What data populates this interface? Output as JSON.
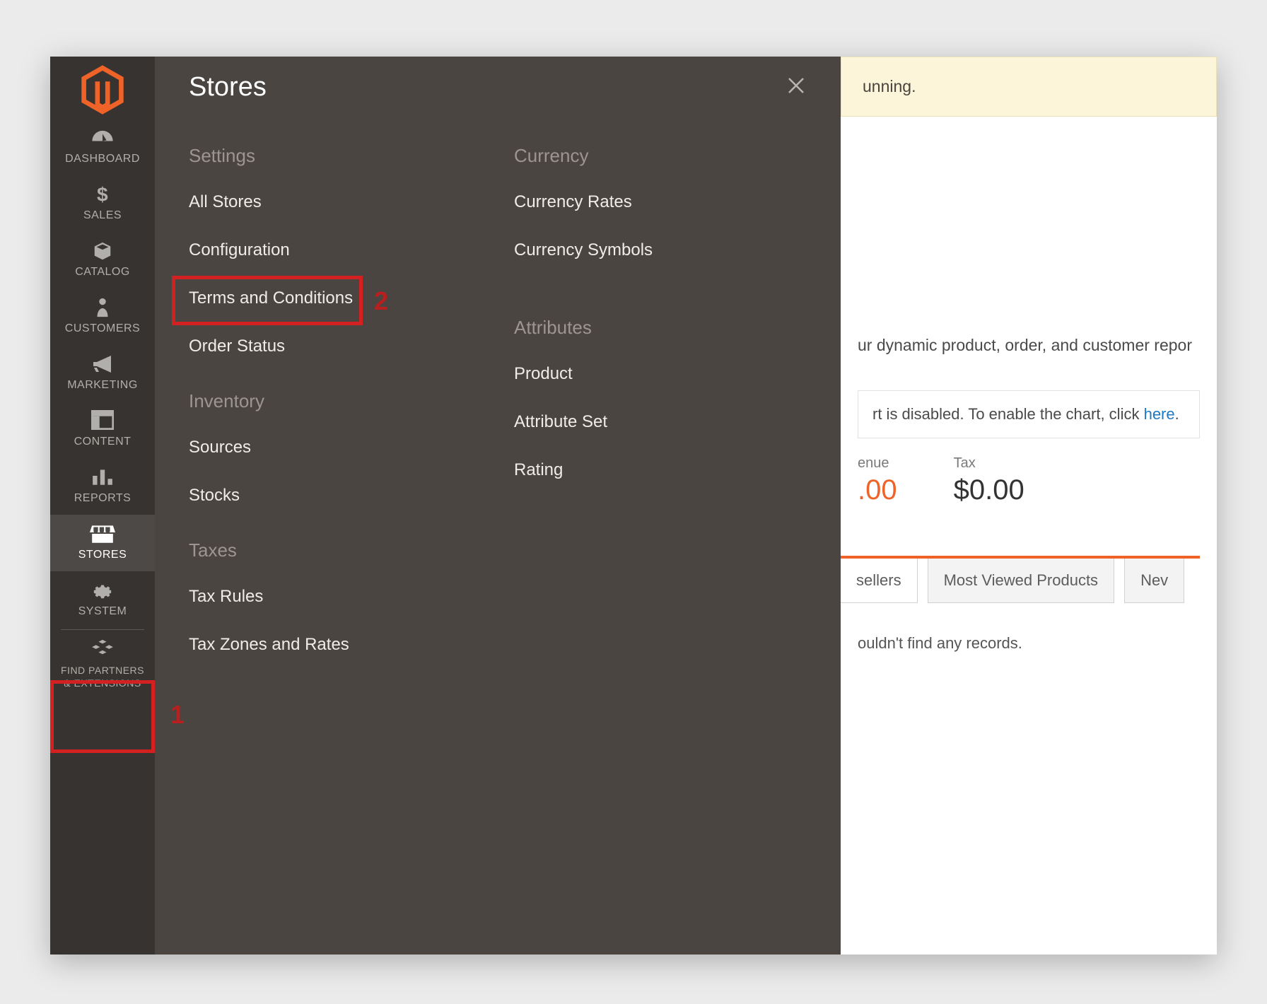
{
  "sidebar": {
    "items": [
      {
        "id": "dashboard",
        "label": "DASHBOARD"
      },
      {
        "id": "sales",
        "label": "SALES"
      },
      {
        "id": "catalog",
        "label": "CATALOG"
      },
      {
        "id": "customers",
        "label": "CUSTOMERS"
      },
      {
        "id": "marketing",
        "label": "MARKETING"
      },
      {
        "id": "content",
        "label": "CONTENT"
      },
      {
        "id": "reports",
        "label": "REPORTS"
      },
      {
        "id": "stores",
        "label": "STORES"
      },
      {
        "id": "system",
        "label": "SYSTEM"
      },
      {
        "id": "partners",
        "label": "FIND PARTNERS & EXTENSIONS"
      }
    ]
  },
  "flyout": {
    "title": "Stores",
    "groups_left": [
      {
        "title": "Settings",
        "items": [
          "All Stores",
          "Configuration",
          "Terms and Conditions",
          "Order Status"
        ]
      },
      {
        "title": "Inventory",
        "items": [
          "Sources",
          "Stocks"
        ]
      },
      {
        "title": "Taxes",
        "items": [
          "Tax Rules",
          "Tax Zones and Rates"
        ]
      }
    ],
    "groups_right": [
      {
        "title": "Currency",
        "items": [
          "Currency Rates",
          "Currency Symbols"
        ]
      },
      {
        "title": "Attributes",
        "items": [
          "Product",
          "Attribute Set",
          "Rating"
        ]
      }
    ]
  },
  "content": {
    "banner_fragment": "unning.",
    "paragraph_fragment": "ur dynamic product, order, and customer repor",
    "chart_note_prefix": "rt is disabled. To enable the chart, click ",
    "chart_note_link": "here",
    "chart_note_suffix": ".",
    "stats": {
      "rev_label": "enue",
      "rev_value": ".00",
      "tax_label": "Tax",
      "tax_value": "$0.00"
    },
    "tabs": [
      "sellers",
      "Most Viewed Products",
      "Nev"
    ],
    "empty": "ouldn't find any records."
  },
  "callouts": {
    "one": "1",
    "two": "2"
  }
}
